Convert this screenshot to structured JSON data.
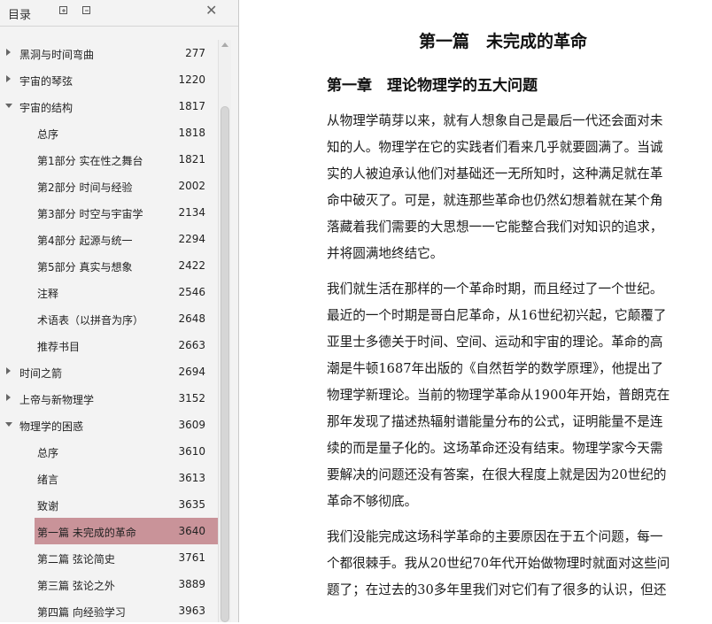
{
  "sidebar": {
    "title": "目录",
    "items": [
      {
        "label": "黑洞与时间弯曲",
        "page": "277",
        "level": 1,
        "state": "collapsed"
      },
      {
        "label": "宇宙的琴弦",
        "page": "1220",
        "level": 1,
        "state": "collapsed"
      },
      {
        "label": "宇宙的结构",
        "page": "1817",
        "level": 1,
        "state": "expanded"
      },
      {
        "label": "总序",
        "page": "1818",
        "level": 2
      },
      {
        "label": "第1部分 实在性之舞台",
        "page": "1821",
        "level": 2
      },
      {
        "label": "第2部分 时间与经验",
        "page": "2002",
        "level": 2
      },
      {
        "label": "第3部分 时空与宇宙学",
        "page": "2134",
        "level": 2
      },
      {
        "label": "第4部分 起源与统一",
        "page": "2294",
        "level": 2
      },
      {
        "label": "第5部分 真实与想象",
        "page": "2422",
        "level": 2
      },
      {
        "label": "注释",
        "page": "2546",
        "level": 2
      },
      {
        "label": "术语表（以拼音为序）",
        "page": "2648",
        "level": 2
      },
      {
        "label": "推荐书目",
        "page": "2663",
        "level": 2
      },
      {
        "label": "时间之箭",
        "page": "2694",
        "level": 1,
        "state": "collapsed"
      },
      {
        "label": "上帝与新物理学",
        "page": "3152",
        "level": 1,
        "state": "collapsed"
      },
      {
        "label": "物理学的困惑",
        "page": "3609",
        "level": 1,
        "state": "expanded"
      },
      {
        "label": "总序",
        "page": "3610",
        "level": 2
      },
      {
        "label": "绪言",
        "page": "3613",
        "level": 2
      },
      {
        "label": "致谢",
        "page": "3635",
        "level": 2
      },
      {
        "label": "第一篇 未完成的革命",
        "page": "3640",
        "level": 2,
        "active": true
      },
      {
        "label": "第二篇 弦论简史",
        "page": "3761",
        "level": 2
      },
      {
        "label": "第三篇 弦论之外",
        "page": "3889",
        "level": 2
      },
      {
        "label": "第四篇 向经验学习",
        "page": "3963",
        "level": 2
      }
    ]
  },
  "document": {
    "part_title": "第一篇　未完成的革命",
    "chapter_title": "第一章　理论物理学的五大问题",
    "paragraphs": [
      [
        "从物理学萌芽以来，就有人想象自己是最后一代还会面对未",
        "知的人。物理学在它的实践者们看来几乎就要圆满了。当诚",
        "实的人被迫承认他们对基础还一无所知时，这种满足就在革",
        "命中破灭了。可是，就连那些革命也仍然幻想着就在某个角",
        "落藏着我们需要的大思想一一它能整合我们对知识的追求，",
        "并将圆满地终结它。"
      ],
      [
        "我们就生活在那样的一个革命时期，而且经过了一个世纪。",
        "最近的一个时期是哥白尼革命，从16世纪初兴起，它颠覆了",
        "亚里士多德关于时间、空间、运动和宇宙的理论。革命的高",
        "潮是牛顿1687年出版的《自然哲学的数学原理》，他提出了",
        "物理学新理论。当前的物理学革命从1900年开始，普朗克在",
        "那年发现了描述热辐射谱能量分布的公式，证明能量不是连",
        "续的而是量子化的。这场革命还没有结束。物理学家今天需",
        "要解决的问题还没有答案，在很大程度上就是因为20世纪的",
        "革命不够彻底。"
      ],
      [
        "我们没能完成这场科学革命的主要原因在于五个问题，每一",
        "个都很棘手。我从20世纪70年代开始做物理时就面对这些问",
        "题了；在过去的30多年里我们对它们有了很多的认识，但还"
      ]
    ]
  },
  "colors": {
    "active_row": "#c99399",
    "sidebar_bg": "#f3f3f3"
  }
}
